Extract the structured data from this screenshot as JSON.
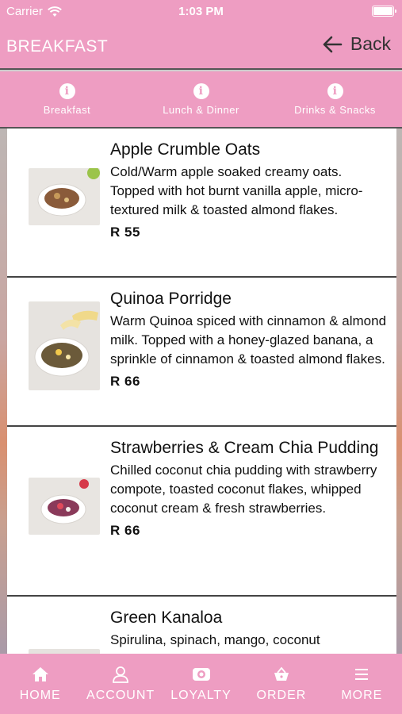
{
  "status_bar": {
    "carrier": "Carrier",
    "time": "1:03 PM"
  },
  "header": {
    "title": "BREAKFAST",
    "back_label": "Back"
  },
  "tabs": [
    {
      "label": "Breakfast",
      "icon": "info-icon"
    },
    {
      "label": "Lunch & Dinner",
      "icon": "info-icon"
    },
    {
      "label": "Drinks & Snacks",
      "icon": "info-icon"
    }
  ],
  "menu_items": [
    {
      "title": "Apple Crumble Oats",
      "description": "Cold/Warm apple soaked creamy oats. Topped with hot burnt vanilla apple, micro-textured milk & toasted almond flakes.",
      "price": "R 55"
    },
    {
      "title": "Quinoa Porridge",
      "description": "Warm Quinoa spiced with cinnamon & almond milk. Topped with a honey-glazed banana, a sprinkle of cinnamon & toasted almond flakes.",
      "price": "R 66"
    },
    {
      "title": "Strawberries & Cream Chia Pudding",
      "description": "Chilled coconut chia pudding with strawberry compote, toasted coconut flakes, whipped coconut cream & fresh strawberries.",
      "price": "R 66"
    },
    {
      "title": "Green Kanaloa",
      "description": "Spirulina, spinach, mango, coconut",
      "price": ""
    }
  ],
  "bottom_nav": [
    {
      "label": "HOME",
      "icon": "home-icon"
    },
    {
      "label": "ACCOUNT",
      "icon": "user-icon"
    },
    {
      "label": "LOYALTY",
      "icon": "loyalty-icon"
    },
    {
      "label": "ORDER",
      "icon": "basket-icon"
    },
    {
      "label": "MORE",
      "icon": "menu-icon"
    }
  ],
  "colors": {
    "brand_pink": "#ee9dc2",
    "text_dark": "#111111"
  }
}
